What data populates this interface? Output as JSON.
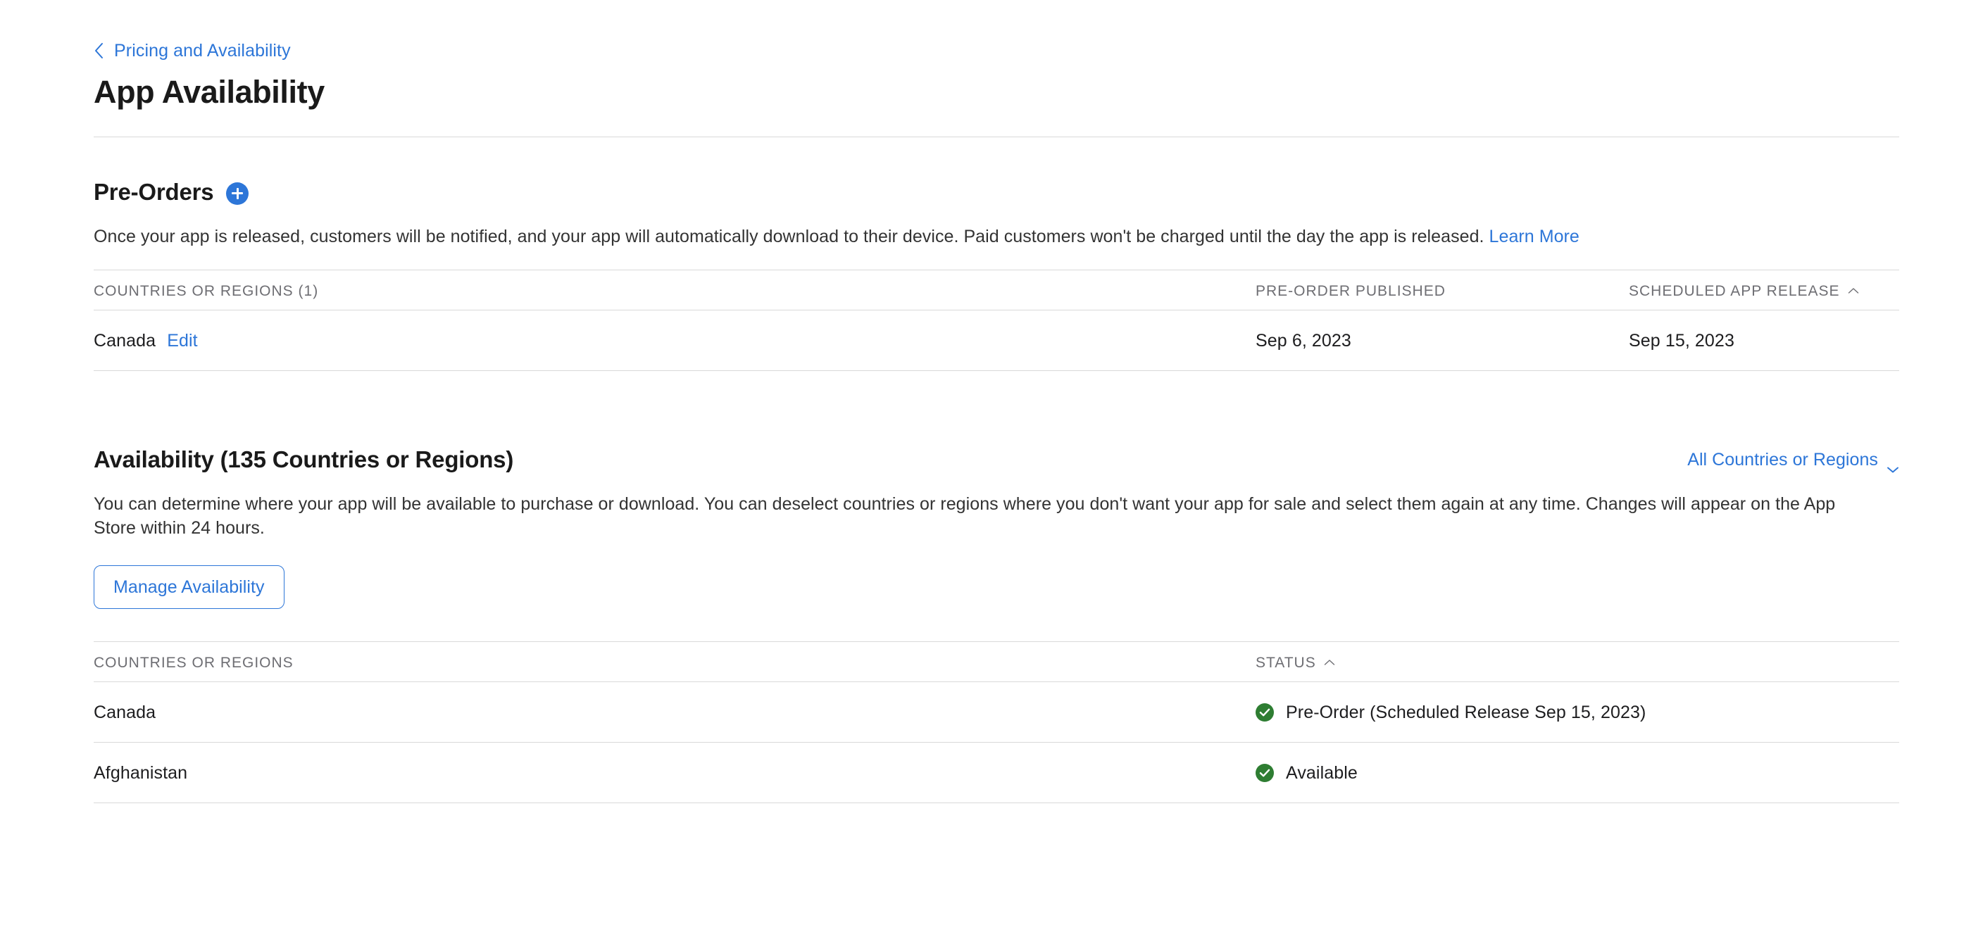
{
  "breadcrumb": {
    "icon": "chevron-left-icon",
    "label": "Pricing and Availability"
  },
  "page_title": "App Availability",
  "colors": {
    "accent_blue": "#2d76d8",
    "status_green": "#2e7d32",
    "divider": "#d9d9d9",
    "text_primary": "#1d1d1f",
    "text_secondary": "#6e6e73"
  },
  "preorders": {
    "title": "Pre-Orders",
    "add_button_icon": "plus-icon",
    "description": "Once your app is released, customers will be notified, and your app will automatically download to their device. Paid customers won't be charged until the day the app is released.",
    "learn_more_label": "Learn More",
    "table": {
      "headers": {
        "countries": "COUNTRIES OR REGIONS (1)",
        "published": "PRE-ORDER PUBLISHED",
        "release": "SCHEDULED APP RELEASE"
      },
      "sort": {
        "column": "SCHEDULED APP RELEASE",
        "direction": "ascending",
        "icon": "caret-up-icon"
      },
      "rows": [
        {
          "country": "Canada",
          "edit_label": "Edit",
          "published": "Sep 6, 2023",
          "release": "Sep 15, 2023"
        }
      ]
    }
  },
  "availability": {
    "title": "Availability (135 Countries or Regions)",
    "count": 135,
    "filter": {
      "label": "All Countries or Regions",
      "icon": "chevron-down-icon"
    },
    "description": "You can determine where your app will be available to purchase or download. You can deselect countries or regions where you don't want your app for sale and select them again at any time. Changes will appear on the App Store within 24 hours.",
    "manage_button_label": "Manage Availability",
    "table": {
      "headers": {
        "countries": "COUNTRIES OR REGIONS",
        "status": "STATUS"
      },
      "sort": {
        "column": "STATUS",
        "direction": "ascending",
        "icon": "caret-up-icon"
      },
      "rows": [
        {
          "country": "Canada",
          "status": "Pre-Order (Scheduled Release Sep 15, 2023)",
          "status_icon": "check-circle-icon"
        },
        {
          "country": "Afghanistan",
          "status": "Available",
          "status_icon": "check-circle-icon"
        }
      ]
    }
  }
}
